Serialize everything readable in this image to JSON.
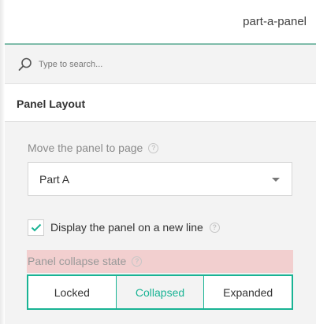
{
  "header": {
    "title": "part-a-panel"
  },
  "search": {
    "placeholder": "Type to search..."
  },
  "section": {
    "title": "Panel Layout"
  },
  "move_panel": {
    "label": "Move the panel to page",
    "selected": "Part A"
  },
  "new_line": {
    "label": "Display the panel on a new line",
    "checked": true
  },
  "collapse": {
    "label": "Panel collapse state",
    "options": [
      "Locked",
      "Collapsed",
      "Expanded"
    ],
    "selected": "Collapsed"
  },
  "colors": {
    "accent": "#19b394",
    "highlight": "#f2cfcf"
  },
  "icons": {
    "search": "search-icon",
    "help": "help-icon",
    "check": "checkmark-icon",
    "dropdown": "chevron-down-icon"
  }
}
